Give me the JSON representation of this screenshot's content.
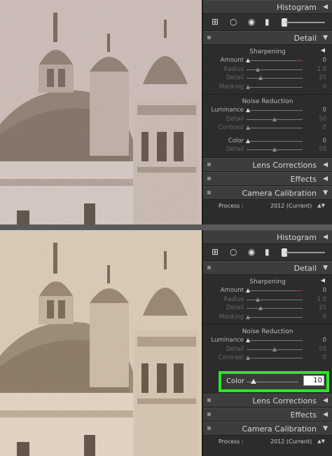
{
  "panels": {
    "histogram": "Histogram",
    "detail": "Detail",
    "lens_corrections": "Lens Corrections",
    "effects": "Effects",
    "camera_calibration": "Camera Calibration"
  },
  "sharpening": {
    "title": "Sharpening",
    "amount": {
      "label": "Amount",
      "value": "0"
    },
    "radius": {
      "label": "Radius",
      "value": "1.0"
    },
    "detail": {
      "label": "Detail",
      "value": "25"
    },
    "masking": {
      "label": "Masking",
      "value": "0"
    }
  },
  "noise_reduction": {
    "title": "Noise Reduction",
    "luminance": {
      "label": "Luminance",
      "value": "0"
    },
    "lum_detail": {
      "label": "Detail",
      "value": "50"
    },
    "contrast": {
      "label": "Contrast",
      "value": "0"
    },
    "color_top": {
      "label": "Color",
      "value": "0"
    },
    "color_detail": {
      "label": "Detail",
      "value": "50"
    }
  },
  "calibration": {
    "process_label": "Process :",
    "process_value": "2012 (Current)"
  },
  "highlight": {
    "label": "Color",
    "value": "10"
  },
  "colors": {
    "highlight_border": "#27e820",
    "panel_bg": "#2c2c2c",
    "amount_track_end": "#a63a3a"
  }
}
